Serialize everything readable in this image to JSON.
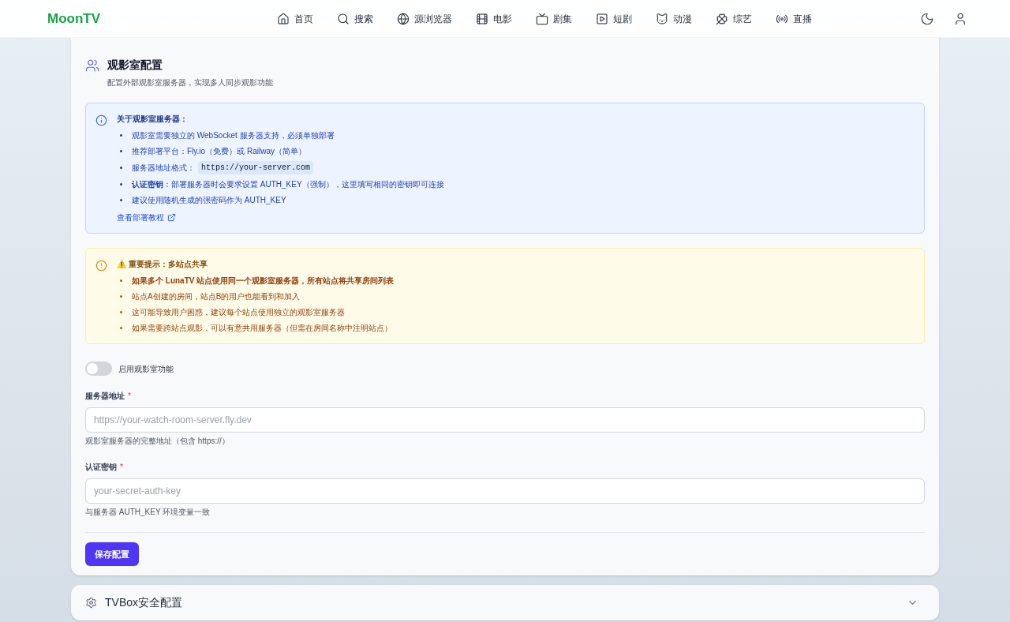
{
  "header": {
    "logo": "MoonTV",
    "nav": [
      {
        "label": "首页",
        "selected": false
      },
      {
        "label": "搜索",
        "selected": false
      },
      {
        "label": "源浏览器",
        "selected": false
      },
      {
        "label": "电影",
        "selected": false
      },
      {
        "label": "剧集",
        "selected": false
      },
      {
        "label": "短剧",
        "selected": false
      },
      {
        "label": "动漫",
        "selected": false
      },
      {
        "label": "综艺",
        "selected": false
      },
      {
        "label": "直播",
        "selected": false
      }
    ]
  },
  "watch_room": {
    "title": "观影室配置",
    "subtitle": "配置外部观影室服务器，实现多人同步观影功能",
    "info": {
      "title": "关于观影室服务器：",
      "items": [
        {
          "text": "观影室需要独立的 WebSocket 服务器支持，必须单独部署"
        },
        {
          "text": "推荐部署平台：Fly.io（免费）或 Railway（简单）"
        },
        {
          "text": "服务器地址格式：",
          "code": "https://your-server.com"
        },
        {
          "text": "**认证密钥**：部署服务器时会要求设置 AUTH_KEY（强制），这里填写相同的密钥即可连接"
        },
        {
          "text": "建议使用随机生成的强密码作为 AUTH_KEY"
        }
      ],
      "link": "查看部署教程"
    },
    "warning": {
      "title": "⚠️ 重要提示：多站点共享",
      "items": [
        {
          "text": "如果多个 LunaTV 站点使用同一个观影室服务器，所有站点将共享房间列表",
          "strong": true
        },
        {
          "text": "站点A创建的房间，站点B的用户也能看到和加入",
          "strong": false
        },
        {
          "text": "这可能导致用户困惑，建议每个站点使用独立的观影室服务器",
          "strong": false
        },
        {
          "text": "如果需要跨站点观影，可以有意共用服务器（但需在房间名称中注明站点）",
          "strong": false
        }
      ]
    },
    "toggle": {
      "label": "启用观影室功能",
      "on": false
    },
    "fields": [
      {
        "label": "服务器地址",
        "required": "*",
        "placeholder": "https://your-watch-room-server.fly.dev",
        "hint": "观影室服务器的完整地址（包含 https://）"
      },
      {
        "label": "认证密钥",
        "required": "*",
        "placeholder": "your-secret-auth-key",
        "hint": "与服务器 AUTH_KEY 环境变量一致"
      }
    ],
    "save_button": "保存配置"
  },
  "sections": [
    {
      "title": "TVBox安全配置",
      "expanded": false
    }
  ]
}
